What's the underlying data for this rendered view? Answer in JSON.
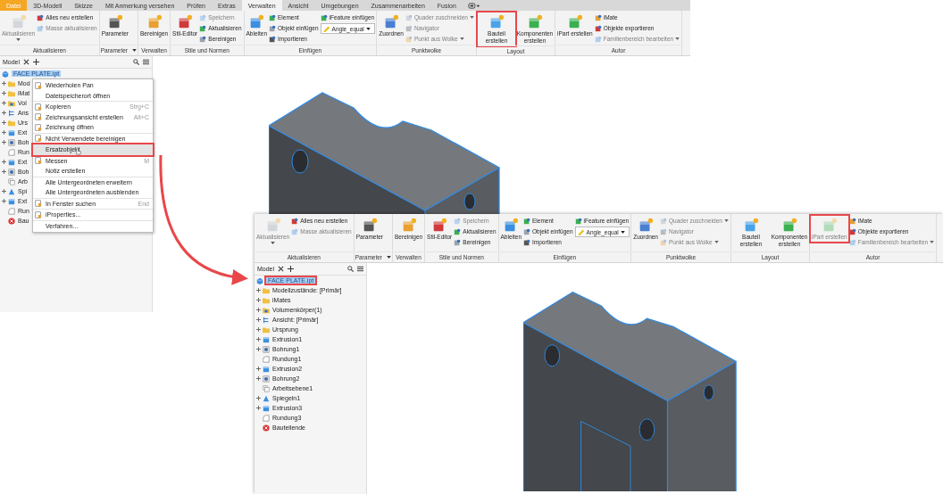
{
  "screenshots": [
    {
      "tabs": [
        {
          "label": "Datei",
          "kind": "file",
          "selected": false
        },
        {
          "label": "3D-Modell",
          "kind": "tab",
          "selected": false
        },
        {
          "label": "Skizze",
          "kind": "tab",
          "selected": false
        },
        {
          "label": "Mit Anmerkung versehen",
          "kind": "tab",
          "selected": false
        },
        {
          "label": "Prüfen",
          "kind": "tab",
          "selected": false
        },
        {
          "label": "Extras",
          "kind": "tab",
          "selected": false
        },
        {
          "label": "Verwalten",
          "kind": "tab",
          "selected": true
        },
        {
          "label": "Ansicht",
          "kind": "tab",
          "selected": false
        },
        {
          "label": "Umgebungen",
          "kind": "tab",
          "selected": false
        },
        {
          "label": "Zusammenarbeiten",
          "kind": "tab",
          "selected": false
        },
        {
          "label": "Fusion",
          "kind": "tab",
          "selected": false
        }
      ],
      "ribbon": [
        {
          "label": "Aktualisieren",
          "dropdown": false,
          "columns": [
            {
              "kind": "large",
              "label": "Aktualisieren",
              "disabled": true,
              "dropdown": true,
              "highlighted": false
            },
            {
              "kind": "stack",
              "items": [
                {
                  "kind": "button",
                  "label": "Alles neu erstellen",
                  "disabled": false,
                  "dropdown": false
                },
                {
                  "kind": "button",
                  "label": "Masse aktualisieren",
                  "disabled": true,
                  "dropdown": false
                }
              ]
            }
          ]
        },
        {
          "label": "Parameter",
          "dropdown": true,
          "columns": [
            {
              "kind": "large",
              "label": "Parameter",
              "disabled": false,
              "dropdown": false,
              "highlighted": false
            }
          ]
        },
        {
          "label": "Verwalten",
          "dropdown": false,
          "columns": [
            {
              "kind": "large",
              "label": "Bereinigen",
              "disabled": false,
              "dropdown": false,
              "highlighted": false
            }
          ]
        },
        {
          "label": "Stile und Normen",
          "dropdown": false,
          "columns": [
            {
              "kind": "large",
              "label": "Stil-Editor",
              "disabled": false,
              "dropdown": false,
              "highlighted": false
            },
            {
              "kind": "stack",
              "items": [
                {
                  "kind": "button",
                  "label": "Speichern",
                  "disabled": true,
                  "dropdown": false
                },
                {
                  "kind": "button",
                  "label": "Aktualisieren",
                  "disabled": false,
                  "dropdown": false
                },
                {
                  "kind": "button",
                  "label": "Bereinigen",
                  "disabled": false,
                  "dropdown": false
                }
              ]
            }
          ]
        },
        {
          "label": "Einfügen",
          "dropdown": false,
          "columns": [
            {
              "kind": "large",
              "label": "Ableiten",
              "disabled": false,
              "dropdown": false,
              "highlighted": false
            },
            {
              "kind": "stack",
              "items": [
                {
                  "kind": "button",
                  "label": "Element",
                  "disabled": false,
                  "dropdown": false
                },
                {
                  "kind": "button",
                  "label": "Objekt einfügen",
                  "disabled": false,
                  "dropdown": false
                },
                {
                  "kind": "button",
                  "label": "Importieren",
                  "disabled": false,
                  "dropdown": false
                }
              ]
            },
            {
              "kind": "stack",
              "items": [
                {
                  "kind": "button",
                  "label": "iFeature einfügen",
                  "disabled": false,
                  "dropdown": false
                },
                {
                  "kind": "combo",
                  "label": "Angle_equal",
                  "disabled": false,
                  "dropdown": true
                }
              ]
            }
          ]
        },
        {
          "label": "Punktwolke",
          "dropdown": false,
          "columns": [
            {
              "kind": "large",
              "label": "Zuordnen",
              "disabled": false,
              "dropdown": false,
              "highlighted": false
            },
            {
              "kind": "stack",
              "items": [
                {
                  "kind": "button",
                  "label": "Quader zuschneiden",
                  "disabled": true,
                  "dropdown": true
                },
                {
                  "kind": "button",
                  "label": "Navigator",
                  "disabled": true,
                  "dropdown": false
                },
                {
                  "kind": "button",
                  "label": "Punkt aus Wolke",
                  "disabled": true,
                  "dropdown": true
                }
              ]
            }
          ]
        },
        {
          "label": "Layout",
          "dropdown": false,
          "columns": [
            {
              "kind": "large",
              "label": "Bauteil erstellen",
              "disabled": false,
              "dropdown": false,
              "highlighted": true
            },
            {
              "kind": "large",
              "label": "Komponenten erstellen",
              "disabled": false,
              "dropdown": false,
              "highlighted": false
            }
          ]
        },
        {
          "label": "Autor",
          "dropdown": false,
          "columns": [
            {
              "kind": "large",
              "label": "iPart erstellen",
              "disabled": false,
              "dropdown": false,
              "highlighted": false
            },
            {
              "kind": "stack",
              "items": [
                {
                  "kind": "button",
                  "label": "iMate",
                  "disabled": false,
                  "dropdown": false
                },
                {
                  "kind": "button",
                  "label": "Objekte exportieren",
                  "disabled": false,
                  "dropdown": false
                },
                {
                  "kind": "button",
                  "label": "Familienbereich bearbeiten",
                  "disabled": true,
                  "dropdown": true
                }
              ]
            }
          ]
        }
      ],
      "browser": {
        "tab_label": "Model",
        "tree": {
          "label": "FACE PLATE.ipt",
          "kind": "part",
          "selected": true,
          "highlighted": false,
          "children": [
            {
              "label": "Mod",
              "kind": "folder",
              "expandable": true
            },
            {
              "label": "iMat",
              "kind": "folder",
              "expandable": true
            },
            {
              "label": "Vol",
              "kind": "bodies",
              "expandable": true
            },
            {
              "label": "Ans",
              "kind": "view",
              "expandable": true
            },
            {
              "label": "Urs",
              "kind": "folder",
              "expandable": true
            },
            {
              "label": "Ext",
              "kind": "extrusion",
              "expandable": true
            },
            {
              "label": "Boh",
              "kind": "hole",
              "expandable": true
            },
            {
              "label": "Run",
              "kind": "fillet",
              "expandable": false
            },
            {
              "label": "Ext",
              "kind": "extrusion",
              "expandable": true
            },
            {
              "label": "Boh",
              "kind": "hole",
              "expandable": true
            },
            {
              "label": "Arb",
              "kind": "plane",
              "expandable": false
            },
            {
              "label": "Spi",
              "kind": "mirror",
              "expandable": true
            },
            {
              "label": "Ext",
              "kind": "extrusion",
              "expandable": true
            },
            {
              "label": "Run",
              "kind": "fillet",
              "expandable": false
            },
            {
              "label": "Bau",
              "kind": "end",
              "expandable": false
            }
          ]
        }
      },
      "context_menu": {
        "groups": [
          [
            {
              "label": "Wiederholen Pan",
              "selected": false,
              "highlighted": false
            },
            {
              "label": "Dateispeicherort öffnen",
              "selected": false,
              "highlighted": false
            }
          ],
          [
            {
              "label": "Kopieren",
              "shortcut": "Strg+C",
              "selected": false,
              "highlighted": false
            },
            {
              "label": "Zeichnungsansicht erstellen",
              "shortcut": "Alt+C",
              "selected": false,
              "highlighted": false
            },
            {
              "label": "Zeichnung öffnen",
              "selected": false,
              "highlighted": false
            }
          ],
          [
            {
              "label": "Nicht Verwendete bereinigen",
              "selected": false,
              "highlighted": false
            }
          ],
          [
            {
              "label": "Ersatzobjekt",
              "selected": true,
              "highlighted": true
            }
          ],
          [
            {
              "label": "Messen",
              "shortcut": "M",
              "selected": false,
              "highlighted": false
            },
            {
              "label": "Notiz erstellen",
              "selected": false,
              "highlighted": false
            }
          ],
          [
            {
              "label": "Alle Untergeordneten erweitern",
              "selected": false,
              "highlighted": false
            },
            {
              "label": "Alle Untergeordneten ausblenden",
              "selected": false,
              "highlighted": false
            }
          ],
          [
            {
              "label": "In Fenster suchen",
              "shortcut": "End",
              "selected": false,
              "highlighted": false
            }
          ],
          [
            {
              "label": "iProperties...",
              "selected": false,
              "highlighted": false
            }
          ],
          [
            {
              "label": "Verfahren...",
              "selected": false,
              "highlighted": false
            }
          ]
        ]
      }
    },
    {
      "ribbon": [
        {
          "label": "Aktualisieren",
          "dropdown": false,
          "columns": [
            {
              "kind": "large",
              "label": "Aktualisieren",
              "disabled": true,
              "dropdown": true,
              "highlighted": false
            },
            {
              "kind": "stack",
              "items": [
                {
                  "kind": "button",
                  "label": "Alles neu erstellen",
                  "disabled": false,
                  "dropdown": false
                },
                {
                  "kind": "button",
                  "label": "Masse aktualisieren",
                  "disabled": true,
                  "dropdown": false
                }
              ]
            }
          ]
        },
        {
          "label": "Parameter",
          "dropdown": true,
          "columns": [
            {
              "kind": "large",
              "label": "Parameter",
              "disabled": false,
              "dropdown": false,
              "highlighted": false
            }
          ]
        },
        {
          "label": "Verwalten",
          "dropdown": false,
          "columns": [
            {
              "kind": "large",
              "label": "Bereinigen",
              "disabled": false,
              "dropdown": false,
              "highlighted": false
            }
          ]
        },
        {
          "label": "Stile und Normen",
          "dropdown": false,
          "columns": [
            {
              "kind": "large",
              "label": "Stil-Editor",
              "disabled": false,
              "dropdown": false,
              "highlighted": false
            },
            {
              "kind": "stack",
              "items": [
                {
                  "kind": "button",
                  "label": "Speichern",
                  "disabled": true,
                  "dropdown": false
                },
                {
                  "kind": "button",
                  "label": "Aktualisieren",
                  "disabled": false,
                  "dropdown": false
                },
                {
                  "kind": "button",
                  "label": "Bereinigen",
                  "disabled": false,
                  "dropdown": false
                }
              ]
            }
          ]
        },
        {
          "label": "Einfügen",
          "dropdown": false,
          "columns": [
            {
              "kind": "large",
              "label": "Ableiten",
              "disabled": false,
              "dropdown": false,
              "highlighted": false
            },
            {
              "kind": "stack",
              "items": [
                {
                  "kind": "button",
                  "label": "Element",
                  "disabled": false,
                  "dropdown": false
                },
                {
                  "kind": "button",
                  "label": "Objekt einfügen",
                  "disabled": false,
                  "dropdown": false
                },
                {
                  "kind": "button",
                  "label": "Importieren",
                  "disabled": false,
                  "dropdown": false
                }
              ]
            },
            {
              "kind": "stack",
              "items": [
                {
                  "kind": "button",
                  "label": "iFeature einfügen",
                  "disabled": false,
                  "dropdown": false
                },
                {
                  "kind": "combo",
                  "label": "Angle_equal",
                  "disabled": false,
                  "dropdown": true
                }
              ]
            }
          ]
        },
        {
          "label": "Punktwolke",
          "dropdown": false,
          "columns": [
            {
              "kind": "large",
              "label": "Zuordnen",
              "disabled": false,
              "dropdown": false,
              "highlighted": false
            },
            {
              "kind": "stack",
              "items": [
                {
                  "kind": "button",
                  "label": "Quader zuschneiden",
                  "disabled": true,
                  "dropdown": true
                },
                {
                  "kind": "button",
                  "label": "Navigator",
                  "disabled": true,
                  "dropdown": false
                },
                {
                  "kind": "button",
                  "label": "Punkt aus Wolke",
                  "disabled": true,
                  "dropdown": true
                }
              ]
            }
          ]
        },
        {
          "label": "Layout",
          "dropdown": false,
          "columns": [
            {
              "kind": "large",
              "label": "Bauteil erstellen",
              "disabled": false,
              "dropdown": false,
              "highlighted": false
            },
            {
              "kind": "large",
              "label": "Komponenten erstellen",
              "disabled": false,
              "dropdown": false,
              "highlighted": false
            }
          ]
        },
        {
          "label": "Autor",
          "dropdown": false,
          "columns": [
            {
              "kind": "large",
              "label": "iPart erstellen",
              "disabled": true,
              "dropdown": false,
              "highlighted": true
            },
            {
              "kind": "stack",
              "items": [
                {
                  "kind": "button",
                  "label": "iMate",
                  "disabled": false,
                  "dropdown": false
                },
                {
                  "kind": "button",
                  "label": "Objekte exportieren",
                  "disabled": false,
                  "dropdown": false
                },
                {
                  "kind": "button",
                  "label": "Familienbereich bearbeiten",
                  "disabled": true,
                  "dropdown": true
                }
              ]
            }
          ]
        }
      ],
      "browser": {
        "tab_label": "Model",
        "tree": {
          "label": "FACE PLATE.ipt",
          "kind": "part",
          "selected": true,
          "highlighted": true,
          "children": [
            {
              "label": "Modellzustände: [Primär]",
              "kind": "folder",
              "expandable": true
            },
            {
              "label": "iMates",
              "kind": "folder",
              "expandable": true
            },
            {
              "label": "Volumenkörper(1)",
              "kind": "bodies",
              "expandable": true
            },
            {
              "label": "Ansicht: [Primär]",
              "kind": "view",
              "expandable": true
            },
            {
              "label": "Ursprung",
              "kind": "folder",
              "expandable": true
            },
            {
              "label": "Extrusion1",
              "kind": "extrusion",
              "expandable": true
            },
            {
              "label": "Bohrung1",
              "kind": "hole",
              "expandable": true
            },
            {
              "label": "Rundung1",
              "kind": "fillet",
              "expandable": false
            },
            {
              "label": "Extrusion2",
              "kind": "extrusion",
              "expandable": true
            },
            {
              "label": "Bohrung2",
              "kind": "hole",
              "expandable": true
            },
            {
              "label": "Arbeitsebene1",
              "kind": "plane",
              "expandable": false
            },
            {
              "label": "Spiegeln1",
              "kind": "mirror",
              "expandable": true
            },
            {
              "label": "Extrusion3",
              "kind": "extrusion",
              "expandable": true
            },
            {
              "label": "Rundung3",
              "kind": "fillet",
              "expandable": false
            },
            {
              "label": "Bauteilende",
              "kind": "end",
              "expandable": false
            }
          ]
        }
      }
    }
  ]
}
